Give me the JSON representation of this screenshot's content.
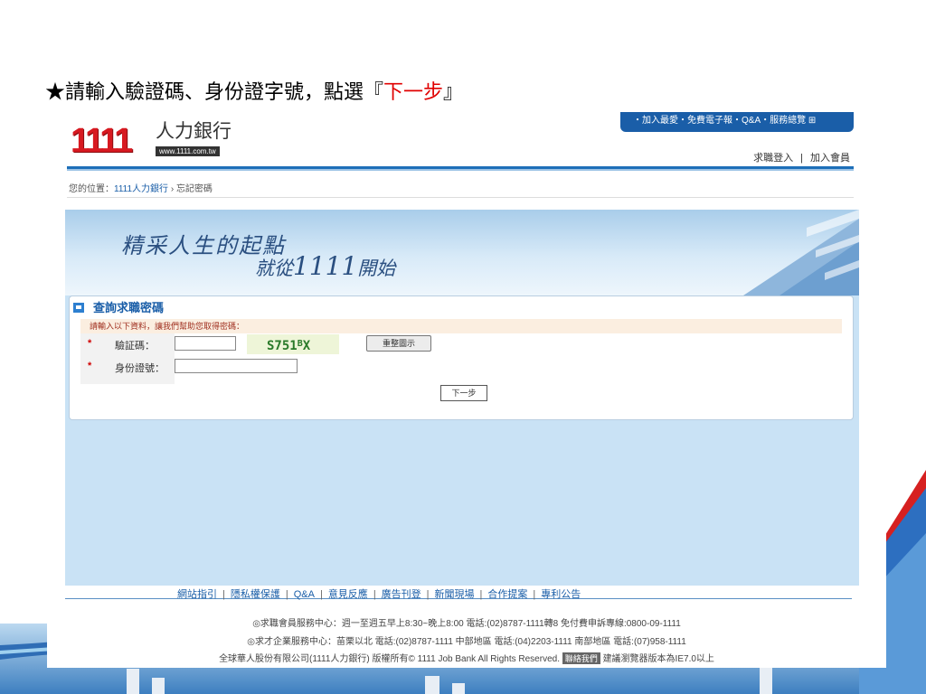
{
  "instruction": {
    "star": "★",
    "prefix": "請輸入驗證碼、身份證字號，點選『",
    "highlight": "下一步",
    "suffix": "』"
  },
  "header": {
    "logo_number": "1111",
    "logo_name": "人力銀行",
    "logo_url": "www.1111.com.tw",
    "top_nav": "・加入最愛・免費電子報・Q&A・服務總覽 ⊞",
    "login_link": "求職登入",
    "divider": "|",
    "join_link": "加入會員"
  },
  "breadcrumb": {
    "prefix": "您的位置：",
    "home": "1111人力銀行",
    "arrow": "›",
    "current": "忘記密碼"
  },
  "banner": {
    "slogan_line1": "精采人生的起點",
    "slogan_line2_pre": "就從",
    "slogan_line2_num": "1111",
    "slogan_line2_post": "開始"
  },
  "form": {
    "section_title": "查詢求職密碼",
    "hint": "請輸入以下資料，讓我們幫助您取得密碼：",
    "required_mark": "*",
    "captcha_label": "驗証碼：",
    "captcha_value": "",
    "captcha_text_main": "S751",
    "captcha_text_sup": "B",
    "captcha_text_end": "X",
    "refresh_label": "重整圖示",
    "id_label": "身份證號：",
    "id_value": "",
    "next_label": "下一步"
  },
  "footer": {
    "links": [
      "網站指引",
      "隱私權保護",
      "Q&A",
      "意見反應",
      "廣告刊登",
      "新聞現場",
      "合作提案",
      "專利公告"
    ],
    "separator": "|",
    "line1": "◎求職會員服務中心：週一至週五早上8:30~晚上8:00 電話:(02)8787-1111轉8 免付費申訴專線:0800-09-1111",
    "line2": "◎求才企業服務中心：苗栗以北 電話:(02)8787-1111 中部地區 電話:(04)2203-1111 南部地區 電話:(07)958-1111",
    "line3_pre": "全球華人股份有限公司(1111人力銀行) 版權所有© 1111 Job Bank All Rights Reserved.",
    "contact": "聯絡我們",
    "line3_post": "建議瀏覽器版本為IE7.0以上"
  },
  "colors": {
    "accent_blue": "#1a5ea8",
    "logo_red": "#d71920",
    "highlight_red": "#e00000",
    "panel_bg": "#c9e2f5"
  }
}
